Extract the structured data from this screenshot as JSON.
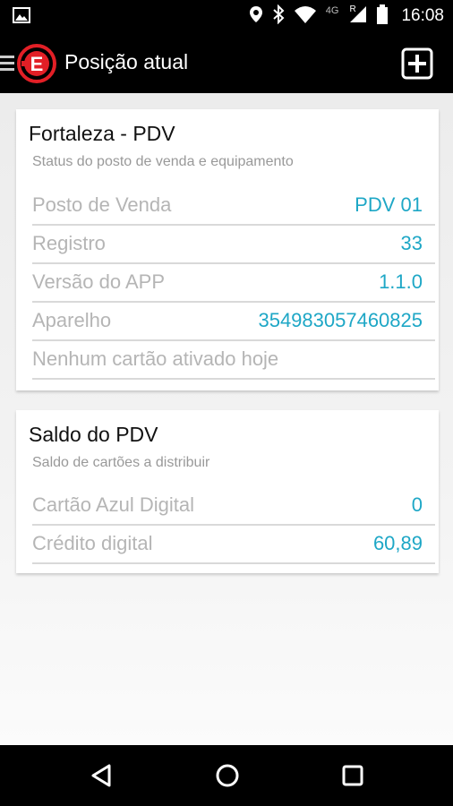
{
  "status_bar": {
    "time": "16:08",
    "network": "4G",
    "roaming": "R",
    "icons": [
      "image-icon",
      "location-icon",
      "bluetooth-icon",
      "wifi-icon",
      "signal-icon",
      "battery-icon"
    ]
  },
  "app_bar": {
    "title": "Posição atual",
    "logo_letter": "E",
    "icons": [
      "menu-icon",
      "logo-icon",
      "add-box-icon"
    ]
  },
  "colors": {
    "value_accent": "#1ea7c6",
    "logo_red": "#e21f26",
    "label_gray": "#b5b5b5"
  },
  "card1": {
    "title": "Fortaleza - PDV",
    "subtitle": "Status do posto de venda e equipamento",
    "rows": [
      {
        "label": "Posto de Venda",
        "value": "PDV 01"
      },
      {
        "label": "Registro",
        "value": "33"
      },
      {
        "label": "Versão do APP",
        "value": "1.1.0"
      },
      {
        "label": "Aparelho",
        "value": "354983057460825"
      },
      {
        "label": "Nenhum cartão ativado hoje",
        "value": ""
      }
    ]
  },
  "card2": {
    "title": "Saldo do PDV",
    "subtitle": "Saldo de cartões a distribuir",
    "rows": [
      {
        "label": "Cartão Azul Digital",
        "value": "0"
      },
      {
        "label": "Crédito digital",
        "value": "60,89"
      }
    ]
  },
  "nav_bar": {
    "icons": [
      "back-icon",
      "home-icon",
      "recents-icon"
    ]
  }
}
